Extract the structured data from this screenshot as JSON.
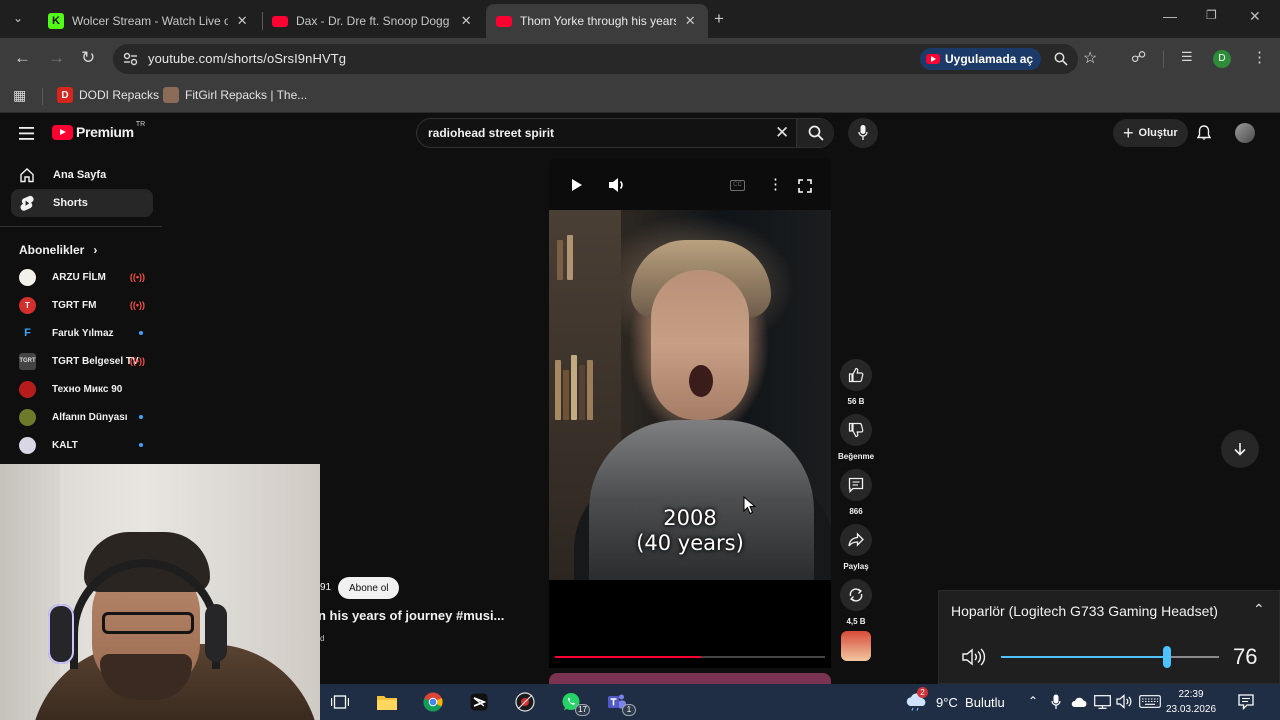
{
  "browser": {
    "tabs": [
      {
        "title": "Wolcer Stream - Watch Live on",
        "favicon": "kick-icon",
        "active": false
      },
      {
        "title": "Dax - Dr. Dre ft. Snoop Dogg \"S",
        "favicon": "youtube-icon",
        "active": false
      },
      {
        "title": "Thom Yorke through his years o",
        "favicon": "youtube-icon",
        "active": true
      }
    ],
    "url": "youtube.com/shorts/oSrsI9nHVTg",
    "open_in_app_label": "Uygulamada aç",
    "profile_initial": "D",
    "bookmarks": [
      {
        "label": "DODI Repacks",
        "icon": "dodi-icon"
      },
      {
        "label": "FitGirl Repacks | The...",
        "icon": "fitgirl-icon"
      }
    ]
  },
  "youtube": {
    "logo_wordmark": "Premium",
    "logo_region": "TR",
    "search_query": "radiohead street spirit",
    "create_label": "Oluştur",
    "sidebar": {
      "items": [
        {
          "label": "Ana Sayfa",
          "icon": "home-icon",
          "active": false
        },
        {
          "label": "Shorts",
          "icon": "shorts-icon",
          "active": true
        }
      ],
      "subscriptions_heading": "Abonelikler",
      "subscriptions": [
        {
          "name": "ARZU FİLM",
          "status": "live",
          "avatar_color": "#f4f1ea"
        },
        {
          "name": "TGRT FM",
          "status": "live",
          "avatar_color": "#d32f2f"
        },
        {
          "name": "Faruk Yılmaz",
          "status": "new",
          "avatar_color": "#0f0f0f"
        },
        {
          "name": "TGRT Belgesel TV",
          "status": "live",
          "avatar_color": "#444444"
        },
        {
          "name": "Техно Микс 90",
          "status": "",
          "avatar_color": "#b71c1c"
        },
        {
          "name": "Alfanın Dünyası",
          "status": "new",
          "avatar_color": "#6d7a2a"
        },
        {
          "name": "KALT",
          "status": "new",
          "avatar_color": "#d9d6e6"
        }
      ]
    },
    "short": {
      "caption_line1": "2008",
      "caption_line2": "(40 years)",
      "progress_fraction": 0.54,
      "title_fragment": "n his years of journey #musi...",
      "subscriber_fragment": "91",
      "meta_fragment": "d",
      "subscribe_label": "Abone ol"
    },
    "actions": {
      "like_count": "56 B",
      "dislike_label": "Beğenme",
      "comment_count": "866",
      "share_label": "Paylaş",
      "remix_count": "4,5 B"
    }
  },
  "volume_flyout": {
    "device": "Hoparlör (Logitech G733 Gaming Headset)",
    "level": 76
  },
  "taskbar": {
    "whatsapp_badge": "17",
    "teams_badge": "1",
    "weather_badge": "2",
    "weather": "9°C  Bulutlu",
    "time": "22:39",
    "date": "23.03.2026"
  },
  "colors": {
    "youtube_red": "#ff0033",
    "accent_blue": "#4cc2ff",
    "page_background": "#0f0f0f",
    "taskbar": "#1f2e44"
  }
}
